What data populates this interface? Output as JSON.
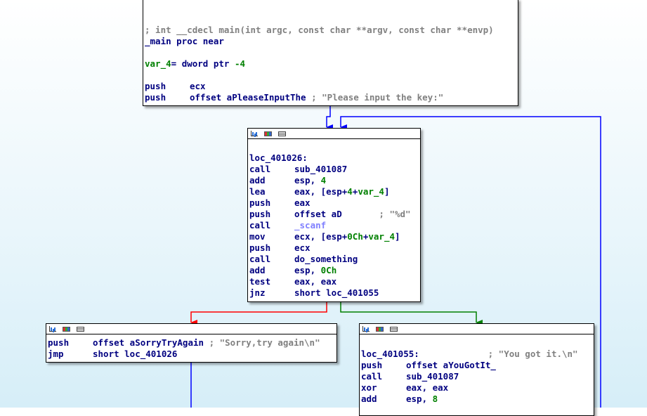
{
  "colors": {
    "edge_unconditional": "#0000ff",
    "edge_true": "#008000",
    "edge_false": "#ff0000",
    "instruction": "#000080",
    "comment": "#808080",
    "number": "#008000",
    "import": "#8080ff"
  },
  "header_icons": [
    "graph-icon",
    "palette-icon",
    "text-view-icon"
  ],
  "node_main": {
    "comment": "; int __cdecl main(int argc, const char **argv, const char **envp)",
    "proc": "_main proc near",
    "var_name": "var_4",
    "var_def": "= dword ptr ",
    "var_off": "-4",
    "i1_mn": "push",
    "i1_op": "ecx",
    "i2_mn": "push",
    "i2_op": "offset aPleaseInputThe",
    "i2_cm": " ; \"Please input the key:\""
  },
  "node_loop": {
    "label": "loc_401026:",
    "i1_mn": "call",
    "i1_op": "sub_401087",
    "i2_mn": "add",
    "i2_op": "esp, ",
    "i2_num": "4",
    "i3_mn": "lea",
    "i3_op_a": "eax, [esp+",
    "i3_num": "4",
    "i3_op_b": "+",
    "i3_var": "var_4",
    "i3_op_c": "]",
    "i4_mn": "push",
    "i4_op": "eax",
    "i5_mn": "push",
    "i5_op": "offset aD       ",
    "i5_cm": "; \"%d\"",
    "i6_mn": "call",
    "i6_op": "_scanf",
    "i7_mn": "mov",
    "i7_op_a": "ecx, [esp+",
    "i7_num": "0Ch",
    "i7_op_b": "+",
    "i7_var": "var_4",
    "i7_op_c": "]",
    "i8_mn": "push",
    "i8_op": "ecx",
    "i9_mn": "call",
    "i9_op": "do_something",
    "i10_mn": "add",
    "i10_op": "esp, ",
    "i10_num": "0Ch",
    "i11_mn": "test",
    "i11_op": "eax, eax",
    "i12_mn": "jnz",
    "i12_op": "short loc_401055"
  },
  "node_sorry": {
    "i1_mn": "push",
    "i1_op": "offset aSorryTryAgain",
    "i1_cm": " ; \"Sorry,try again\\n\"",
    "i2_mn": "jmp",
    "i2_op": "short loc_401026"
  },
  "node_got": {
    "label": "loc_401055:",
    "label_cm": "             ; \"You got it.\\n\"",
    "i1_mn": "push",
    "i1_op": "offset aYouGotIt_",
    "i2_mn": "call",
    "i2_op": "sub_401087",
    "i3_mn": "xor",
    "i3_op": "eax, eax",
    "i4_mn": "add",
    "i4_op": "esp, ",
    "i4_num": "8"
  }
}
